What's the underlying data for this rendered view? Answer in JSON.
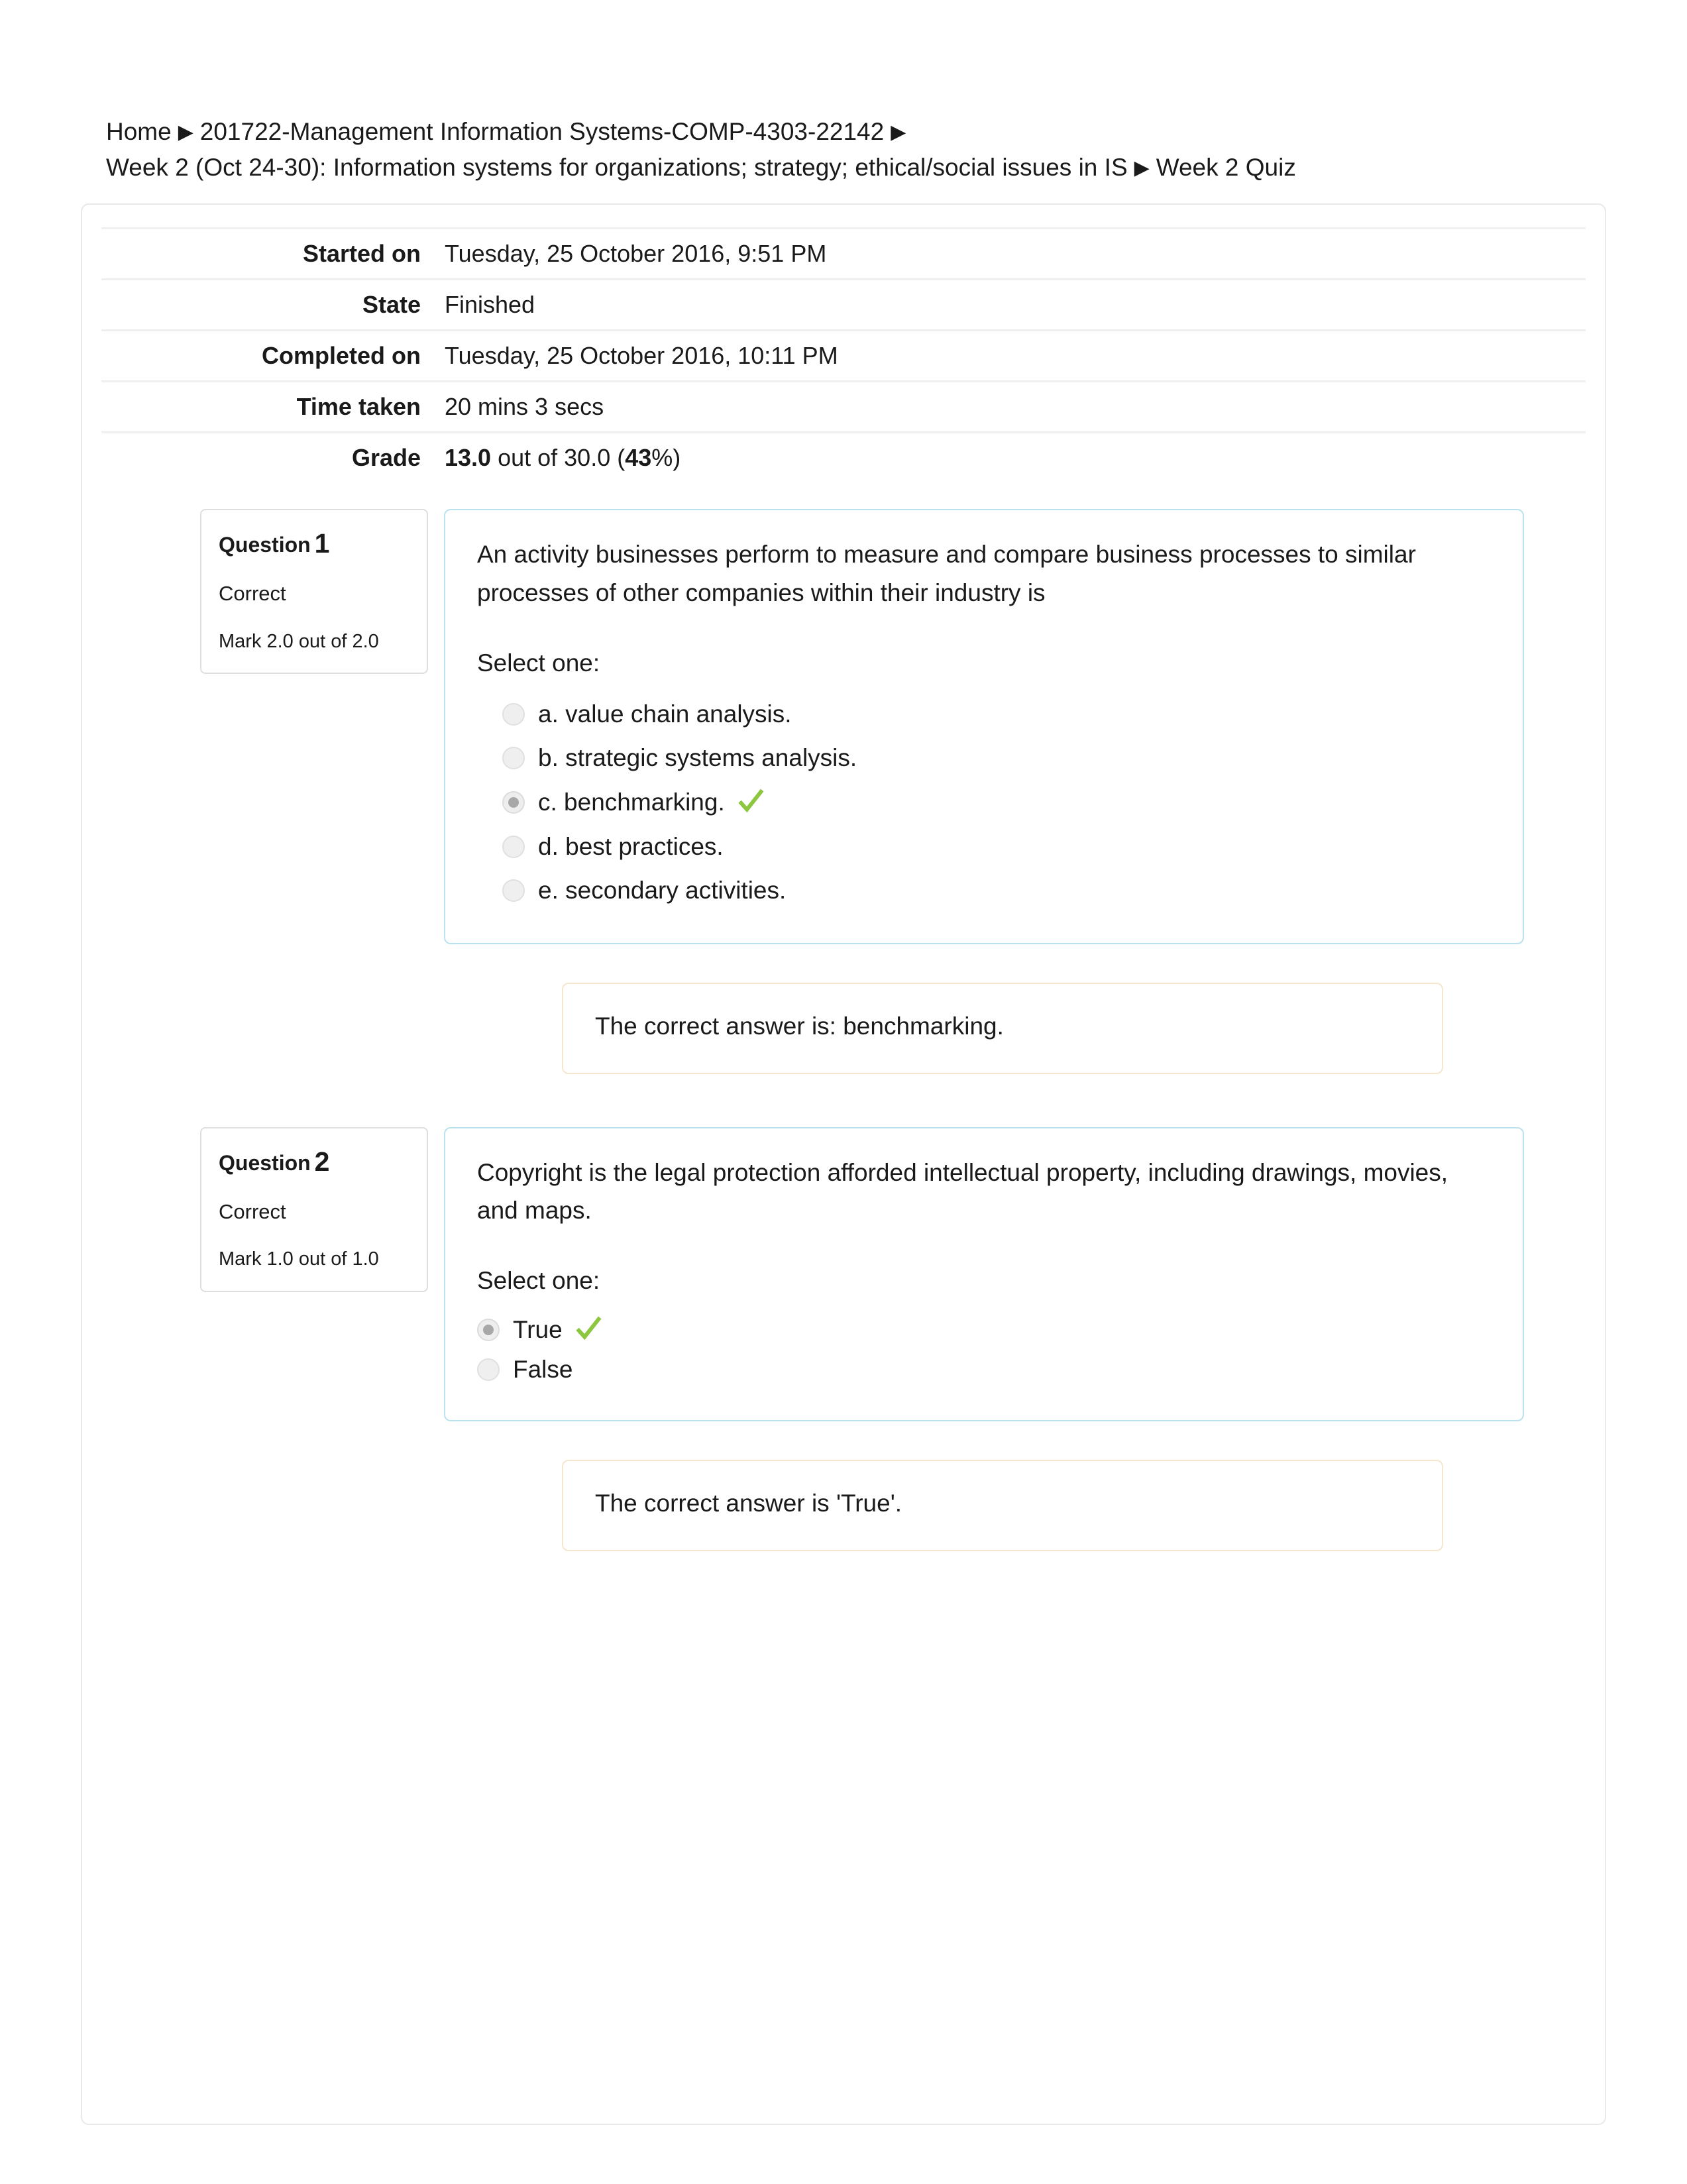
{
  "breadcrumb": {
    "separator": "▶",
    "items": [
      "Home",
      "201722-Management Information Systems-COMP-4303-22142",
      "Week 2 (Oct 24-30): Information systems for organizations; strategy; ethical/social issues in IS",
      "Week 2 Quiz"
    ]
  },
  "summary": {
    "rows": [
      {
        "label": "Started on",
        "value": "Tuesday, 25 October 2016, 9:51 PM"
      },
      {
        "label": "State",
        "value": "Finished"
      },
      {
        "label": "Completed on",
        "value": "Tuesday, 25 October 2016, 10:11 PM"
      },
      {
        "label": "Time taken",
        "value": "20 mins 3 secs"
      }
    ],
    "grade": {
      "label": "Grade",
      "score": "13.0",
      "middle": " out of 30.0 (",
      "percent": "43",
      "suffix": "%)"
    }
  },
  "colors": {
    "question_border": "#b9e2ee",
    "info_border": "#dedede",
    "feedback_border": "#f5e6cd",
    "card_border": "#e9e9e9",
    "correct_tick": "#8dc63f",
    "radio_fill": "#efefef",
    "radio_dot": "#a8a8a8",
    "rule": "#efefef"
  },
  "questions": [
    {
      "label": "Question",
      "number": "1",
      "state": "Correct",
      "mark": "Mark 2.0 out of 2.0",
      "text": "An activity businesses perform to measure and compare business processes to similar processes of other companies within their industry is",
      "select_prompt": "Select one:",
      "options": [
        {
          "label": "a. value chain analysis.",
          "selected": false,
          "correct": false
        },
        {
          "label": "b. strategic systems analysis.",
          "selected": false,
          "correct": false
        },
        {
          "label": "c. benchmarking.",
          "selected": true,
          "correct": true
        },
        {
          "label": "d. best practices.",
          "selected": false,
          "correct": false
        },
        {
          "label": "e. secondary activities.",
          "selected": false,
          "correct": false
        }
      ],
      "feedback": "The correct answer is: benchmarking."
    },
    {
      "label": "Question",
      "number": "2",
      "state": "Correct",
      "mark": "Mark 1.0 out of 1.0",
      "text": "Copyright is the legal protection afforded intellectual property, including drawings, movies, and maps.",
      "select_prompt": "Select one:",
      "options": [
        {
          "label": "True",
          "selected": true,
          "correct": true
        },
        {
          "label": "False",
          "selected": false,
          "correct": false
        }
      ],
      "feedback": "The correct answer is 'True'."
    }
  ]
}
